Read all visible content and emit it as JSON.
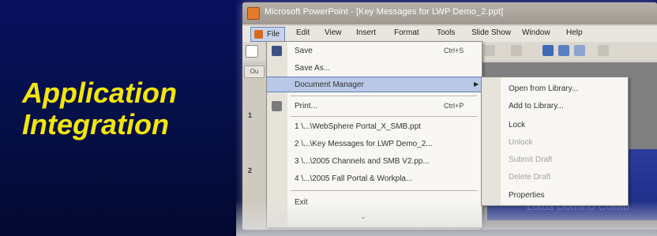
{
  "slide": {
    "title_line1": "Application",
    "title_line2": "Integration"
  },
  "window": {
    "title": "Microsoft PowerPoint - [Key Messages for LWP Demo_2.ppt]"
  },
  "menubar": {
    "items": [
      "File",
      "Edit",
      "View",
      "Insert",
      "Format",
      "Tools",
      "Slide Show",
      "Window",
      "Help"
    ]
  },
  "side_panel": {
    "tab_label": "Ou",
    "slide_numbers": [
      "1",
      "2"
    ]
  },
  "file_menu": {
    "items": [
      {
        "label": "Save",
        "shortcut": "Ctrl+S",
        "icon": "save-icon"
      },
      {
        "label": "Save As...",
        "shortcut": "",
        "icon": ""
      },
      {
        "label": "Document Manager",
        "shortcut": "",
        "icon": "",
        "submenu": true
      },
      {
        "label": "Print...",
        "shortcut": "Ctrl+P",
        "icon": "print-icon"
      },
      {
        "label": "1 \\...\\WebSphere Portal_X_SMB.ppt",
        "shortcut": "",
        "icon": ""
      },
      {
        "label": "2 \\...\\Key Messages for LWP Demo_2...",
        "shortcut": "",
        "icon": ""
      },
      {
        "label": "3 \\...\\2005 Channels and SMB V2.pp...",
        "shortcut": "",
        "icon": ""
      },
      {
        "label": "4 \\...\\2005 Fall Portal & Workpla...",
        "shortcut": "",
        "icon": ""
      },
      {
        "label": "Exit",
        "shortcut": "",
        "icon": ""
      }
    ],
    "expand_glyph": "¥"
  },
  "document_manager_submenu": {
    "items": [
      {
        "label": "Open from Library...",
        "disabled": false
      },
      {
        "label": "Add to Library...",
        "disabled": false
      },
      {
        "label": "Lock",
        "disabled": false
      },
      {
        "label": "Unlock",
        "disabled": true
      },
      {
        "label": "Submit Draft",
        "disabled": true
      },
      {
        "label": "Delete Draft",
        "disabled": true
      },
      {
        "label": "Properties",
        "disabled": false
      }
    ]
  },
  "canvas": {
    "watermark": "Lotus Domino Collab"
  },
  "colors": {
    "background": "#06104a",
    "title": "#f3e60a",
    "highlight": "#b8c8e6"
  }
}
